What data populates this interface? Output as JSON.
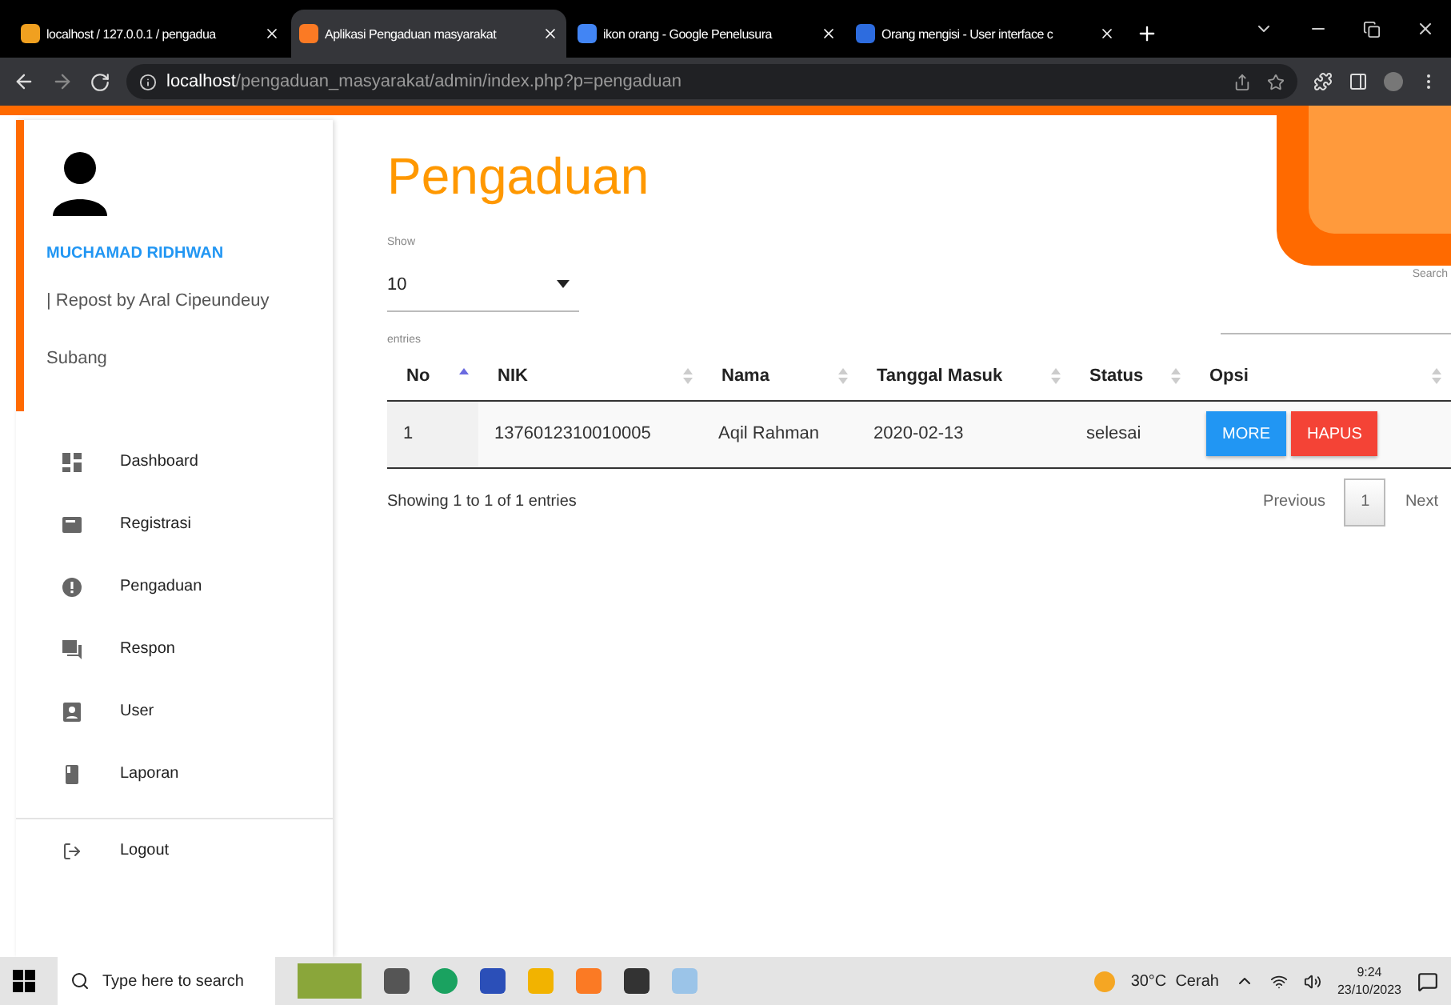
{
  "browser": {
    "tabs": [
      {
        "title": "localhost / 127.0.0.1 / pengadua",
        "kind": "db",
        "selected": false
      },
      {
        "title": "Aplikasi Pengaduan masyarakat",
        "kind": "xampp",
        "selected": true
      },
      {
        "title": "ikon orang - Google Penelusura",
        "kind": "google",
        "selected": false
      },
      {
        "title": "Orang mengisi - User interface c",
        "kind": "people",
        "selected": false
      }
    ],
    "address": {
      "host": "localhost",
      "path": "/pengaduan_masyarakat/admin/index.php?p=pengaduan"
    }
  },
  "sidebar": {
    "user": {
      "name": "MUCHAMAD RIDHWAN",
      "note": "| Repost by Aral Cipeundeuy",
      "city": "Subang"
    },
    "menu": [
      {
        "label": "Dashboard",
        "kind": "dashboard"
      },
      {
        "label": "Registrasi",
        "kind": "card"
      },
      {
        "label": "Pengaduan",
        "kind": "alert"
      },
      {
        "label": "Respon",
        "kind": "chat"
      },
      {
        "label": "User",
        "kind": "user"
      },
      {
        "label": "Laporan",
        "kind": "book"
      }
    ],
    "logout": "Logout"
  },
  "main": {
    "title": "Pengaduan",
    "show_label": "Show",
    "page_length": "10",
    "entries_label": "entries",
    "search_label": "Search",
    "columns": [
      {
        "label": "No",
        "sorted": true
      },
      {
        "label": "NIK",
        "sorted": false
      },
      {
        "label": "Nama",
        "sorted": false
      },
      {
        "label": "Tanggal Masuk",
        "sorted": false
      },
      {
        "label": "Status",
        "sorted": false
      },
      {
        "label": "Opsi",
        "sorted": false
      }
    ],
    "rows": [
      {
        "no": "1",
        "nik": "1376012310010005",
        "nama": "Aqil Rahman",
        "tanggal": "2020-02-13",
        "status": "selesai",
        "actions": [
          {
            "label": "MORE",
            "kind": "more"
          },
          {
            "label": "HAPUS",
            "kind": "delete"
          }
        ]
      }
    ],
    "info": "Showing 1 to 1 of 1 entries",
    "pagination": {
      "previous": "Previous",
      "pages": [
        {
          "label": "1",
          "selected": true
        }
      ],
      "next": "Next"
    }
  },
  "taskbar": {
    "search_placeholder": "Type here to search",
    "weather": "30°C  Cerah",
    "time": "9:24",
    "date": "23/10/2023"
  }
}
